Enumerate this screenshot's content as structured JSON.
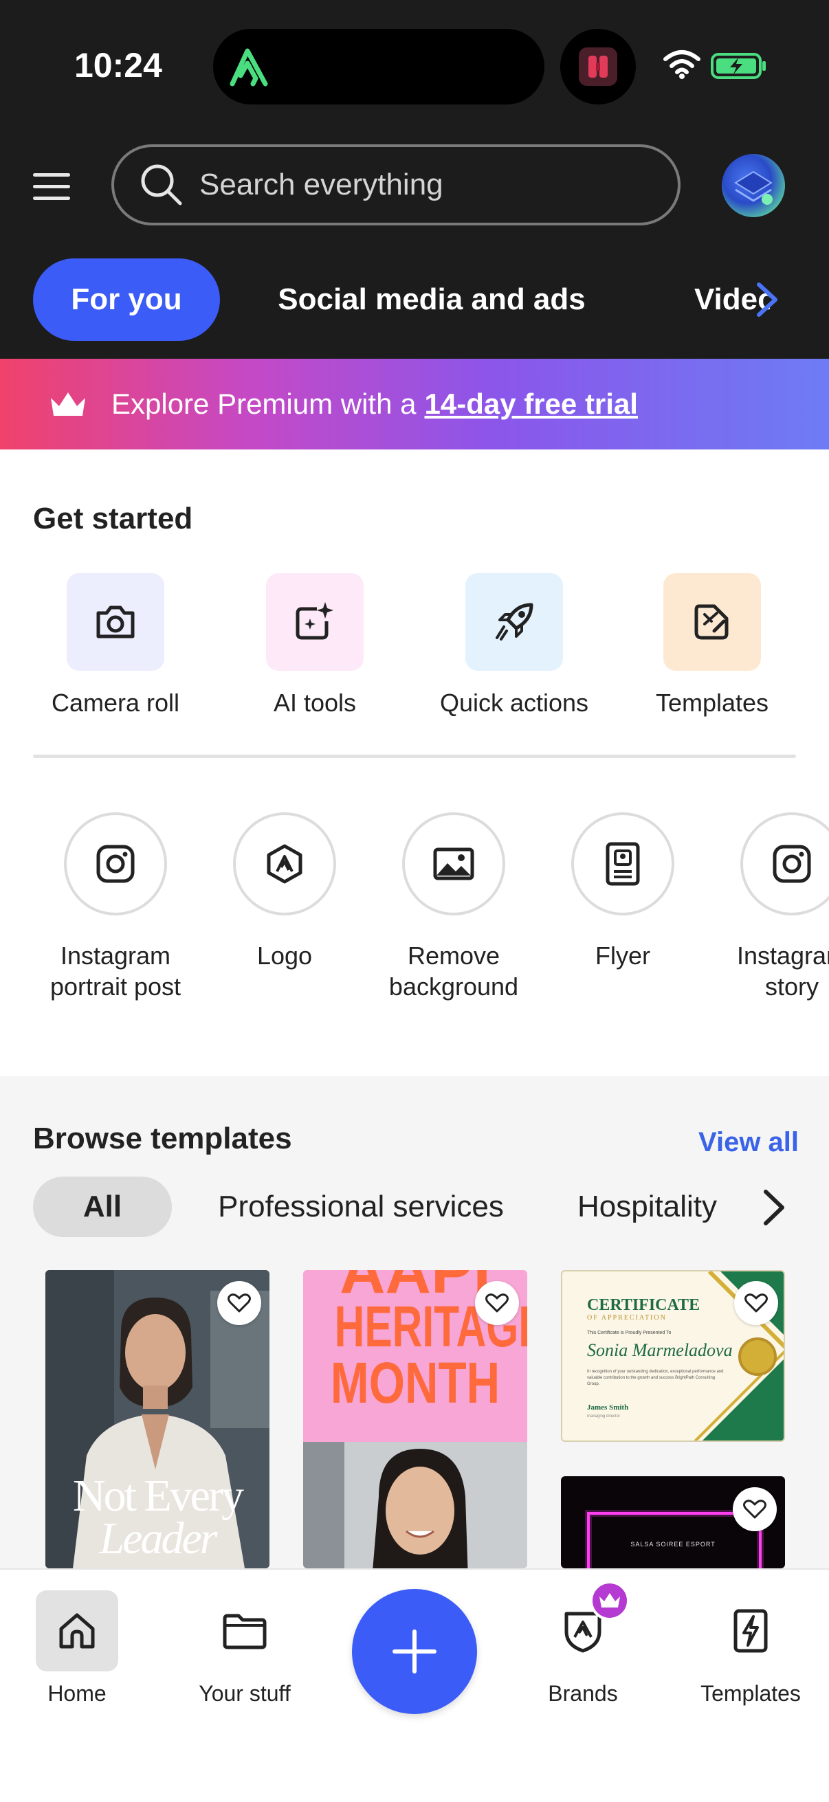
{
  "status_bar": {
    "time": "10:24"
  },
  "header": {
    "search_placeholder": "Search everything"
  },
  "tabs": [
    {
      "label": "For you",
      "active": true
    },
    {
      "label": "Social media and ads",
      "active": false
    },
    {
      "label": "Video",
      "active": false
    }
  ],
  "promo": {
    "prefix": "Explore Premium with a",
    "link": "14-day free trial"
  },
  "get_started": {
    "title": "Get started",
    "actions": [
      {
        "label": "Camera roll",
        "icon": "camera-icon",
        "color": "#ecedfd"
      },
      {
        "label": "AI tools",
        "icon": "sparkle-image-icon",
        "color": "#fde9f7"
      },
      {
        "label": "Quick actions",
        "icon": "rocket-icon",
        "color": "#e3f2fd"
      },
      {
        "label": "Templates",
        "icon": "template-icon",
        "color": "#fde9d2"
      }
    ],
    "shortcuts": [
      {
        "line1": "Instagram",
        "line2": "portrait post",
        "icon": "instagram-icon"
      },
      {
        "line1": "Logo",
        "line2": "",
        "icon": "logo-icon"
      },
      {
        "line1": "Remove",
        "line2": "background",
        "icon": "image-icon"
      },
      {
        "line1": "Flyer",
        "line2": "",
        "icon": "flyer-icon"
      },
      {
        "line1": "Instagram",
        "line2": "story",
        "icon": "instagram-icon"
      }
    ]
  },
  "browse": {
    "title": "Browse templates",
    "view_all": "View all",
    "chips": [
      {
        "label": "All",
        "active": true
      },
      {
        "label": "Professional services",
        "active": false
      },
      {
        "label": "Hospitality",
        "active": false
      }
    ],
    "cards": {
      "leader_line1": "Not Every",
      "leader_line2": "Leader",
      "heritage_line1": "AAPI",
      "heritage_line2": "HERITAGE",
      "heritage_line3": "MONTH",
      "cert_title": "CERTIFICATE",
      "cert_sub": "OF APPRECIATION",
      "cert_presented": "This Certificate is Proudly Presented To",
      "cert_name": "Sonia Marmeladova",
      "cert_body": "In recognition of your outstanding dedication, exceptional performance and valuable contribution to the growth and success BrightPath Consulting Group.",
      "cert_signer": "James Smith",
      "cert_role": "managing director",
      "salsa": "SALSA SOIREE ESPORT"
    }
  },
  "bottom_nav": {
    "home": "Home",
    "your_stuff": "Your stuff",
    "brands": "Brands",
    "templates": "Templates"
  },
  "colors": {
    "accent": "#3b5cf6",
    "header_bg": "#1c1c1c",
    "link": "#3b63e8",
    "premium": "#b43ad1"
  }
}
